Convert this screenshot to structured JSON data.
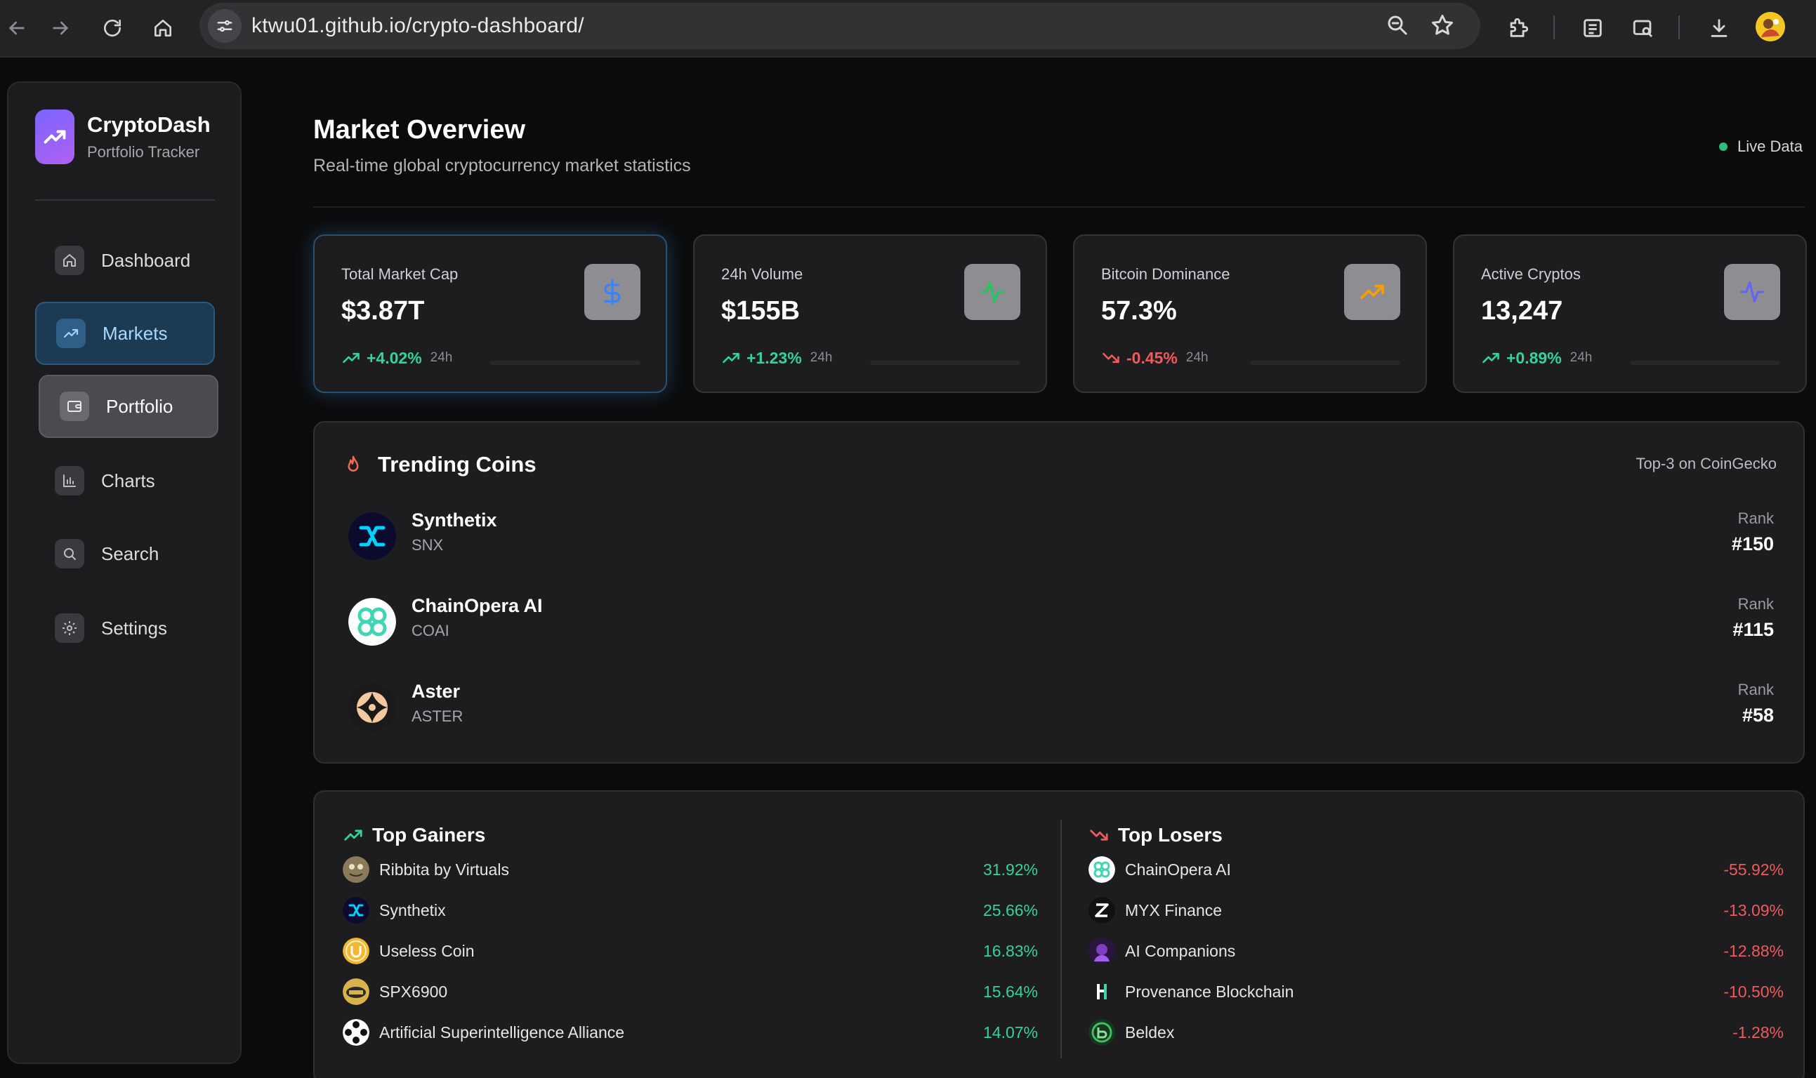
{
  "browser": {
    "url": "ktwu01.github.io/crypto-dashboard/"
  },
  "sidebar": {
    "brand_name": "CryptoDash",
    "brand_sub": "Portfolio Tracker",
    "items": [
      {
        "label": "Dashboard",
        "icon": "home-icon",
        "state": "normal"
      },
      {
        "label": "Markets",
        "icon": "trending-up-icon",
        "state": "active"
      },
      {
        "label": "Portfolio",
        "icon": "wallet-icon",
        "state": "hover"
      },
      {
        "label": "Charts",
        "icon": "bar-chart-icon",
        "state": "normal"
      },
      {
        "label": "Search",
        "icon": "search-icon",
        "state": "normal"
      },
      {
        "label": "Settings",
        "icon": "gear-icon",
        "state": "normal"
      }
    ]
  },
  "header": {
    "title": "Market Overview",
    "subtitle": "Real-time global cryptocurrency market statistics",
    "live_label": "Live Data"
  },
  "stats": [
    {
      "label": "Total Market Cap",
      "value": "$3.87T",
      "change": "+4.02%",
      "period": "24h",
      "direction": "up",
      "icon": "dollar-icon",
      "icon_color": "#3b82f6"
    },
    {
      "label": "24h Volume",
      "value": "$155B",
      "change": "+1.23%",
      "period": "24h",
      "direction": "up",
      "icon": "activity-icon",
      "icon_color": "#22c55e"
    },
    {
      "label": "Bitcoin Dominance",
      "value": "57.3%",
      "change": "-0.45%",
      "period": "24h",
      "direction": "down",
      "icon": "trending-up-icon",
      "icon_color": "#f59e0b"
    },
    {
      "label": "Active Cryptos",
      "value": "13,247",
      "change": "+0.89%",
      "period": "24h",
      "direction": "up",
      "icon": "activity-icon",
      "icon_color": "#6366f1"
    }
  ],
  "trending": {
    "title": "Trending Coins",
    "source": "Top-3 on CoinGecko",
    "rank_label": "Rank",
    "coins": [
      {
        "name": "Synthetix",
        "symbol": "SNX",
        "rank": "#150"
      },
      {
        "name": "ChainOpera AI",
        "symbol": "COAI",
        "rank": "#115"
      },
      {
        "name": "Aster",
        "symbol": "ASTER",
        "rank": "#58"
      }
    ]
  },
  "gainers": {
    "title": "Top Gainers",
    "items": [
      {
        "name": "Ribbita by Virtuals",
        "pct": "31.92%"
      },
      {
        "name": "Synthetix",
        "pct": "25.66%"
      },
      {
        "name": "Useless Coin",
        "pct": "16.83%"
      },
      {
        "name": "SPX6900",
        "pct": "15.64%"
      },
      {
        "name": "Artificial Superintelligence Alliance",
        "pct": "14.07%"
      }
    ]
  },
  "losers": {
    "title": "Top Losers",
    "items": [
      {
        "name": "ChainOpera AI",
        "pct": "-55.92%"
      },
      {
        "name": "MYX Finance",
        "pct": "-13.09%"
      },
      {
        "name": "AI Companions",
        "pct": "-12.88%"
      },
      {
        "name": "Provenance Blockchain",
        "pct": "-10.50%"
      },
      {
        "name": "Beldex",
        "pct": "-1.28%"
      }
    ]
  },
  "colors": {
    "up": "#34d399",
    "down": "#f05a5a",
    "accent": "#a9d8ff"
  }
}
